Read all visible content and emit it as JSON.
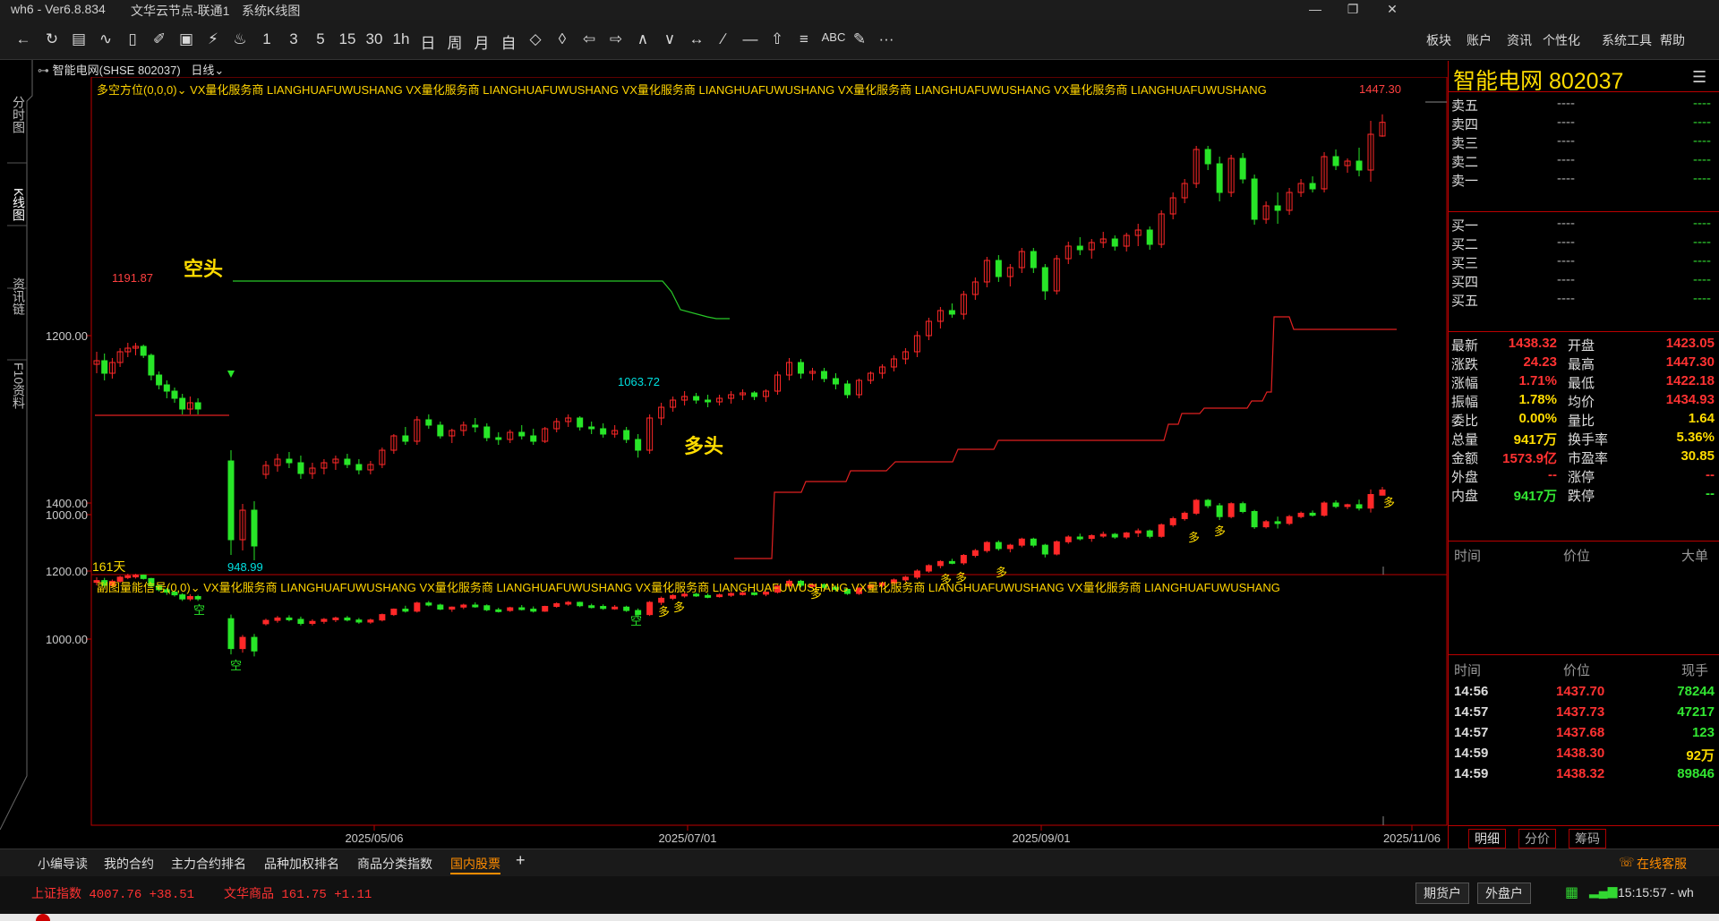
{
  "titlebar": {
    "app": "wh6 - Ver6.8.834",
    "server": "文华云节点-联通1",
    "view": "系统K线图"
  },
  "toolbar": {
    "periods": [
      "1",
      "3",
      "5",
      "15",
      "30",
      "1h",
      "日",
      "周",
      "月",
      "自"
    ],
    "menus": [
      "板块",
      "账户",
      "资讯",
      "个性化",
      "系统工具",
      "帮助"
    ],
    "abc": "ABC",
    "more": "···"
  },
  "left_tabs": [
    "分时图",
    "K线图",
    "资讯链",
    "F10资料"
  ],
  "chart": {
    "symbol_label": "智能电网(SHSE 802037)",
    "period_label": "日线",
    "main_indicator": "多空方位(0,0,0)",
    "sub_indicator": "副图量能信号(0,0)",
    "ad_text": [
      "VX量化服务商",
      "LIANGHUAFUWUSHANG",
      "VX量化服务商",
      "LIANGHUAFUWUSHANG",
      "VX量化服务商",
      "LIANGHUAFUWUSHANG",
      "VX量化服务商",
      "LIANGHUAFUWUSHANG",
      "VX量化服务商",
      "LIANGHUAFUWUSHANG"
    ],
    "kong_label": "空头",
    "duo_label": "多头",
    "days_label": "161天",
    "annotations": {
      "high_left": "1191.87",
      "low": "948.99",
      "mid_low": "1063.72",
      "high": "1447.30"
    },
    "main_y_ticks": [
      "1200.00",
      "1000.00"
    ],
    "sub_y_ticks": [
      "1400.00",
      "1200.00",
      "1000.00"
    ],
    "x_ticks": [
      "2025/05/06",
      "2025/07/01",
      "2025/09/01",
      "2025/11/06"
    ],
    "signal_duo": "多",
    "signal_kong": "空"
  },
  "chart_data": {
    "type": "candlestick",
    "y_range": [
      920,
      1470
    ],
    "candles": [
      [
        1168,
        1182,
        1158,
        1172
      ],
      [
        1172,
        1180,
        1150,
        1158
      ],
      [
        1158,
        1175,
        1152,
        1170
      ],
      [
        1170,
        1186,
        1165,
        1182
      ],
      [
        1182,
        1192,
        1176,
        1186
      ],
      [
        1186,
        1191.87,
        1178,
        1188
      ],
      [
        1188,
        1190,
        1175,
        1178
      ],
      [
        1178,
        1180,
        1150,
        1156
      ],
      [
        1156,
        1160,
        1140,
        1145
      ],
      [
        1145,
        1150,
        1130,
        1138
      ],
      [
        1138,
        1142,
        1125,
        1130
      ],
      [
        1130,
        1135,
        1112,
        1118
      ],
      [
        1118,
        1132,
        1112,
        1125
      ],
      [
        1125,
        1130,
        1112,
        1118
      ],
      [
        1060,
        1072,
        955,
        972
      ],
      [
        972,
        1012,
        960,
        1005
      ],
      [
        1005,
        1015,
        948.99,
        965
      ],
      [
        1045,
        1060,
        1040,
        1055
      ],
      [
        1055,
        1068,
        1048,
        1062
      ],
      [
        1062,
        1070,
        1052,
        1058
      ],
      [
        1058,
        1066,
        1040,
        1046
      ],
      [
        1046,
        1058,
        1040,
        1052
      ],
      [
        1052,
        1062,
        1045,
        1058
      ],
      [
        1058,
        1066,
        1050,
        1062
      ],
      [
        1062,
        1068,
        1052,
        1056
      ],
      [
        1056,
        1062,
        1045,
        1050
      ],
      [
        1050,
        1060,
        1045,
        1056
      ],
      [
        1056,
        1075,
        1052,
        1072
      ],
      [
        1072,
        1090,
        1068,
        1088
      ],
      [
        1088,
        1098,
        1078,
        1082
      ],
      [
        1082,
        1110,
        1078,
        1106
      ],
      [
        1106,
        1112,
        1096,
        1100
      ],
      [
        1100,
        1104,
        1085,
        1088
      ],
      [
        1088,
        1096,
        1080,
        1094
      ],
      [
        1094,
        1104,
        1088,
        1100
      ],
      [
        1100,
        1108,
        1092,
        1098
      ],
      [
        1098,
        1102,
        1082,
        1086
      ],
      [
        1086,
        1092,
        1078,
        1084
      ],
      [
        1084,
        1095,
        1080,
        1092
      ],
      [
        1092,
        1100,
        1084,
        1088
      ],
      [
        1088,
        1096,
        1078,
        1082
      ],
      [
        1082,
        1098,
        1080,
        1096
      ],
      [
        1096,
        1108,
        1092,
        1104
      ],
      [
        1104,
        1112,
        1098,
        1108
      ],
      [
        1108,
        1110,
        1094,
        1098
      ],
      [
        1098,
        1104,
        1090,
        1096
      ],
      [
        1096,
        1102,
        1086,
        1090
      ],
      [
        1090,
        1100,
        1086,
        1094
      ],
      [
        1094,
        1098,
        1080,
        1084
      ],
      [
        1084,
        1090,
        1063.72,
        1072
      ],
      [
        1072,
        1112,
        1068,
        1108
      ],
      [
        1108,
        1125,
        1100,
        1120
      ],
      [
        1120,
        1132,
        1115,
        1128
      ],
      [
        1128,
        1138,
        1122,
        1132
      ],
      [
        1132,
        1136,
        1124,
        1128
      ],
      [
        1128,
        1134,
        1120,
        1126
      ],
      [
        1126,
        1134,
        1122,
        1130
      ],
      [
        1130,
        1138,
        1124,
        1134
      ],
      [
        1134,
        1140,
        1128,
        1136
      ],
      [
        1136,
        1138,
        1128,
        1132
      ],
      [
        1132,
        1140,
        1126,
        1138
      ],
      [
        1138,
        1160,
        1134,
        1156
      ],
      [
        1156,
        1175,
        1150,
        1170
      ],
      [
        1170,
        1174,
        1152,
        1158
      ],
      [
        1158,
        1164,
        1150,
        1160
      ],
      [
        1160,
        1164,
        1148,
        1152
      ],
      [
        1152,
        1158,
        1140,
        1146
      ],
      [
        1146,
        1150,
        1130,
        1134
      ],
      [
        1134,
        1152,
        1130,
        1150
      ],
      [
        1150,
        1160,
        1146,
        1158
      ],
      [
        1158,
        1168,
        1152,
        1165
      ],
      [
        1165,
        1178,
        1160,
        1174
      ],
      [
        1174,
        1186,
        1168,
        1182
      ],
      [
        1182,
        1205,
        1176,
        1200
      ],
      [
        1200,
        1220,
        1195,
        1216
      ],
      [
        1216,
        1232,
        1208,
        1228
      ],
      [
        1228,
        1236,
        1220,
        1224
      ],
      [
        1224,
        1250,
        1218,
        1246
      ],
      [
        1246,
        1265,
        1240,
        1260
      ],
      [
        1260,
        1288,
        1254,
        1284
      ],
      [
        1284,
        1290,
        1260,
        1266
      ],
      [
        1266,
        1280,
        1255,
        1276
      ],
      [
        1276,
        1298,
        1270,
        1294
      ],
      [
        1294,
        1298,
        1270,
        1276
      ],
      [
        1276,
        1280,
        1240,
        1250
      ],
      [
        1250,
        1290,
        1246,
        1286
      ],
      [
        1286,
        1305,
        1280,
        1300
      ],
      [
        1300,
        1310,
        1290,
        1296
      ],
      [
        1296,
        1308,
        1286,
        1304
      ],
      [
        1304,
        1316,
        1298,
        1308
      ],
      [
        1308,
        1312,
        1295,
        1300
      ],
      [
        1300,
        1315,
        1294,
        1312
      ],
      [
        1312,
        1325,
        1300,
        1318
      ],
      [
        1318,
        1322,
        1296,
        1302
      ],
      [
        1302,
        1340,
        1298,
        1336
      ],
      [
        1336,
        1360,
        1330,
        1354
      ],
      [
        1354,
        1375,
        1348,
        1370
      ],
      [
        1370,
        1412,
        1365,
        1408
      ],
      [
        1408,
        1412,
        1385,
        1392
      ],
      [
        1392,
        1400,
        1350,
        1360
      ],
      [
        1360,
        1402,
        1355,
        1398
      ],
      [
        1398,
        1404,
        1370,
        1375
      ],
      [
        1375,
        1380,
        1324,
        1330
      ],
      [
        1330,
        1350,
        1325,
        1345
      ],
      [
        1345,
        1360,
        1325,
        1340
      ],
      [
        1340,
        1365,
        1335,
        1360
      ],
      [
        1360,
        1375,
        1355,
        1370
      ],
      [
        1370,
        1378,
        1360,
        1364
      ],
      [
        1364,
        1405,
        1360,
        1400
      ],
      [
        1400,
        1408,
        1385,
        1390
      ],
      [
        1390,
        1398,
        1382,
        1395
      ],
      [
        1395,
        1410,
        1378,
        1385
      ],
      [
        1385,
        1440,
        1372,
        1425
      ],
      [
        1423.05,
        1447.3,
        1422.18,
        1438.32
      ]
    ]
  },
  "quote": {
    "name": "智能电网",
    "code": "802037",
    "sell": [
      {
        "label": "卖五",
        "price": "----",
        "vol": "----"
      },
      {
        "label": "卖四",
        "price": "----",
        "vol": "----"
      },
      {
        "label": "卖三",
        "price": "----",
        "vol": "----"
      },
      {
        "label": "卖二",
        "price": "----",
        "vol": "----"
      },
      {
        "label": "卖一",
        "price": "----",
        "vol": "----"
      }
    ],
    "buy": [
      {
        "label": "买一",
        "price": "----",
        "vol": "----"
      },
      {
        "label": "买二",
        "price": "----",
        "vol": "----"
      },
      {
        "label": "买三",
        "price": "----",
        "vol": "----"
      },
      {
        "label": "买四",
        "price": "----",
        "vol": "----"
      },
      {
        "label": "买五",
        "price": "----",
        "vol": "----"
      }
    ],
    "stats": [
      {
        "l1": "最新",
        "v1": "1438.32",
        "c1": "red",
        "l2": "开盘",
        "v2": "1423.05",
        "c2": "red"
      },
      {
        "l1": "涨跌",
        "v1": "24.23",
        "c1": "red",
        "l2": "最高",
        "v2": "1447.30",
        "c2": "red"
      },
      {
        "l1": "涨幅",
        "v1": "1.71%",
        "c1": "red",
        "l2": "最低",
        "v2": "1422.18",
        "c2": "red"
      },
      {
        "l1": "振幅",
        "v1": "1.78%",
        "c1": "yellow",
        "l2": "均价",
        "v2": "1434.93",
        "c2": "red"
      },
      {
        "l1": "委比",
        "v1": "0.00%",
        "c1": "yellow",
        "l2": "量比",
        "v2": "1.64",
        "c2": "yellow"
      },
      {
        "l1": "总量",
        "v1": "9417万",
        "c1": "yellow",
        "l2": "换手率",
        "v2": "5.36%",
        "c2": "yellow"
      },
      {
        "l1": "金额",
        "v1": "1573.9亿",
        "c1": "red",
        "l2": "市盈率",
        "v2": "30.85",
        "c2": "yellow"
      },
      {
        "l1": "外盘",
        "v1": "--",
        "c1": "red",
        "l2": "涨停",
        "v2": "--",
        "c2": "red"
      },
      {
        "l1": "内盘",
        "v1": "9417万",
        "c1": "green",
        "l2": "跌停",
        "v2": "--",
        "c2": "green"
      }
    ],
    "big_head": {
      "time": "时间",
      "price": "价位",
      "big": "大单"
    },
    "trade_head": {
      "time": "时间",
      "price": "价位",
      "vol": "现手"
    },
    "trades": [
      {
        "time": "14:56",
        "price": "1437.70",
        "vol": "78244",
        "vc": "green"
      },
      {
        "time": "14:57",
        "price": "1437.73",
        "vol": "47217",
        "vc": "green"
      },
      {
        "time": "14:57",
        "price": "1437.68",
        "vol": "123",
        "vc": "green"
      },
      {
        "time": "14:59",
        "price": "1438.30",
        "vol": "92万",
        "vc": "yellow"
      },
      {
        "time": "14:59",
        "price": "1438.32",
        "vol": "89846",
        "vc": "green"
      }
    ],
    "tabs": [
      "明细",
      "分价",
      "筹码"
    ]
  },
  "bottom_tabs": [
    "小编导读",
    "我的合约",
    "主力合约排名",
    "品种加权排名",
    "商品分类指数",
    "国内股票"
  ],
  "service": "在线客服",
  "status": {
    "idx1_name": "上证指数",
    "idx1_val": "4007.76",
    "idx1_chg": "+38.51",
    "idx2_name": "文华商品",
    "idx2_val": "161.75",
    "idx2_chg": "+1.11",
    "btn1": "期货户",
    "btn2": "外盘户",
    "clock": "15:15:57 - wh"
  }
}
